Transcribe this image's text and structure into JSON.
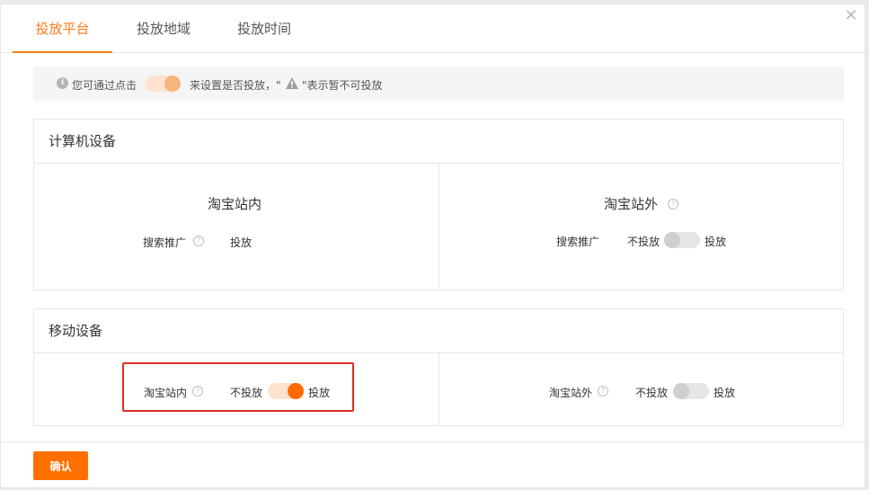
{
  "tabs": [
    {
      "label": "投放平台",
      "active": true
    },
    {
      "label": "投放地域",
      "active": false
    },
    {
      "label": "投放时间",
      "active": false
    }
  ],
  "tip": {
    "text_before": "您可通过点击",
    "text_middle": "来设置是否投放，\"",
    "text_after": "\"表示暂不可投放"
  },
  "desktop": {
    "title": "计算机设备",
    "inside": {
      "title": "淘宝站内",
      "label": "搜索推广",
      "status": "投放"
    },
    "outside": {
      "title": "淘宝站外",
      "label": "搜索推广",
      "off_label": "不投放",
      "on_label": "投放",
      "enabled": false
    }
  },
  "mobile": {
    "title": "移动设备",
    "inside": {
      "label": "淘宝站内",
      "off_label": "不投放",
      "on_label": "投放",
      "enabled": true
    },
    "outside": {
      "label": "淘宝站外",
      "off_label": "不投放",
      "on_label": "投放",
      "enabled": false
    }
  },
  "footer": {
    "confirm_label": "确认"
  },
  "colors": {
    "accent": "#ff7a1a",
    "highlight": "#d93025"
  }
}
